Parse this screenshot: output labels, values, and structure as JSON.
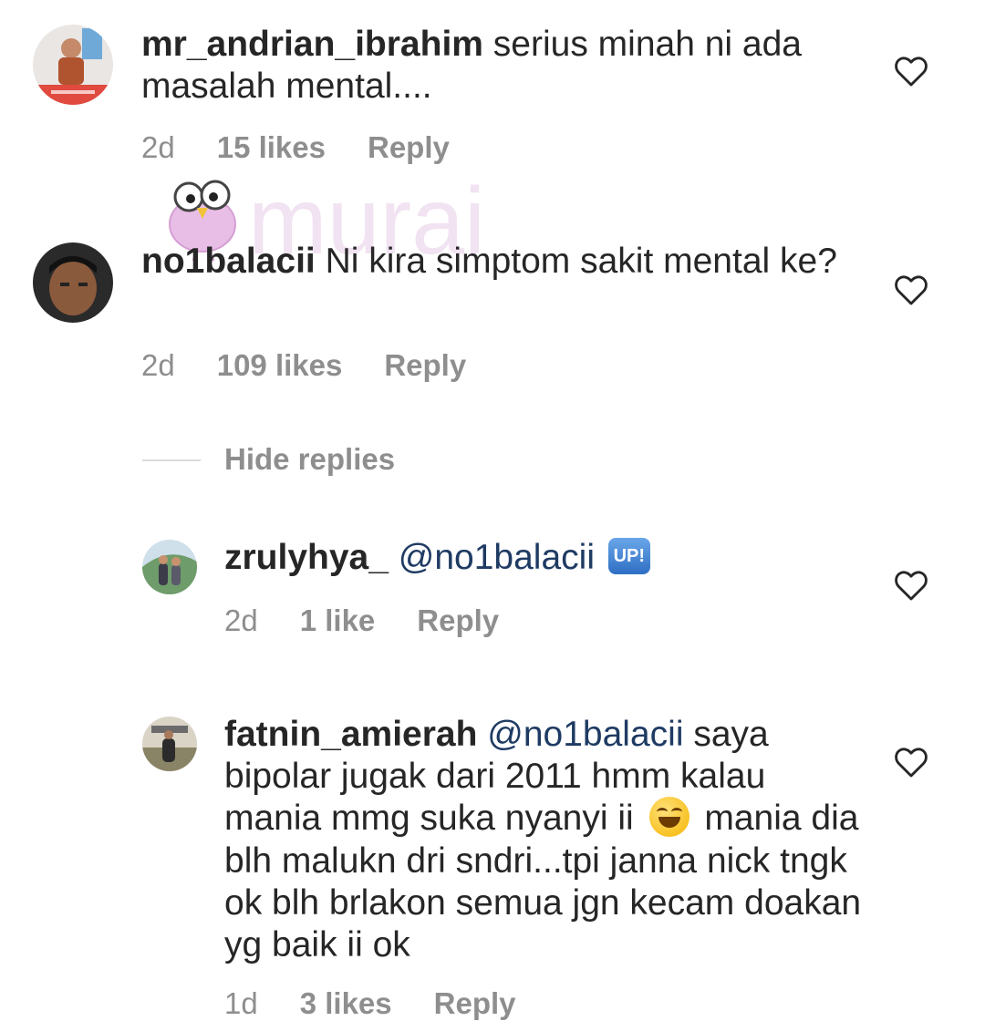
{
  "comments": [
    {
      "username": "mr_andrian_ibrahim",
      "text": " serius minah ni ada masalah mental....",
      "time": "2d",
      "likes": "15 likes",
      "reply": "Reply"
    },
    {
      "username": "no1balacii",
      "text": " Ni kira simptom sakit mental ke?",
      "time": "2d",
      "likes": "109 likes",
      "reply": "Reply"
    }
  ],
  "hide_replies": "Hide replies",
  "replies": [
    {
      "username": "zrulyhya_",
      "mention": "@no1balacii",
      "emoji": "UP!",
      "time": "2d",
      "likes": "1 like",
      "reply": "Reply"
    },
    {
      "username": "fatnin_amierah",
      "mention": "@no1balacii",
      "text_before_emoji": " saya bipolar jugak dari 2011 hmm kalau mania mmg suka nyanyi ii",
      "emoji": "face-with-tears-of-joy",
      "text_after_emoji": " mania dia blh malukn dri sndri...tpi janna nick tngk ok blh brlakon semua jgn kecam doakan yg baik ii ok",
      "time": "1d",
      "likes": "3 likes",
      "reply": "Reply"
    }
  ],
  "watermark": {
    "text": "murai",
    "color": "#f3e6f3"
  },
  "colors": {
    "text": "#262626",
    "meta": "#8e8e8e",
    "mention": "#1f3b63"
  }
}
